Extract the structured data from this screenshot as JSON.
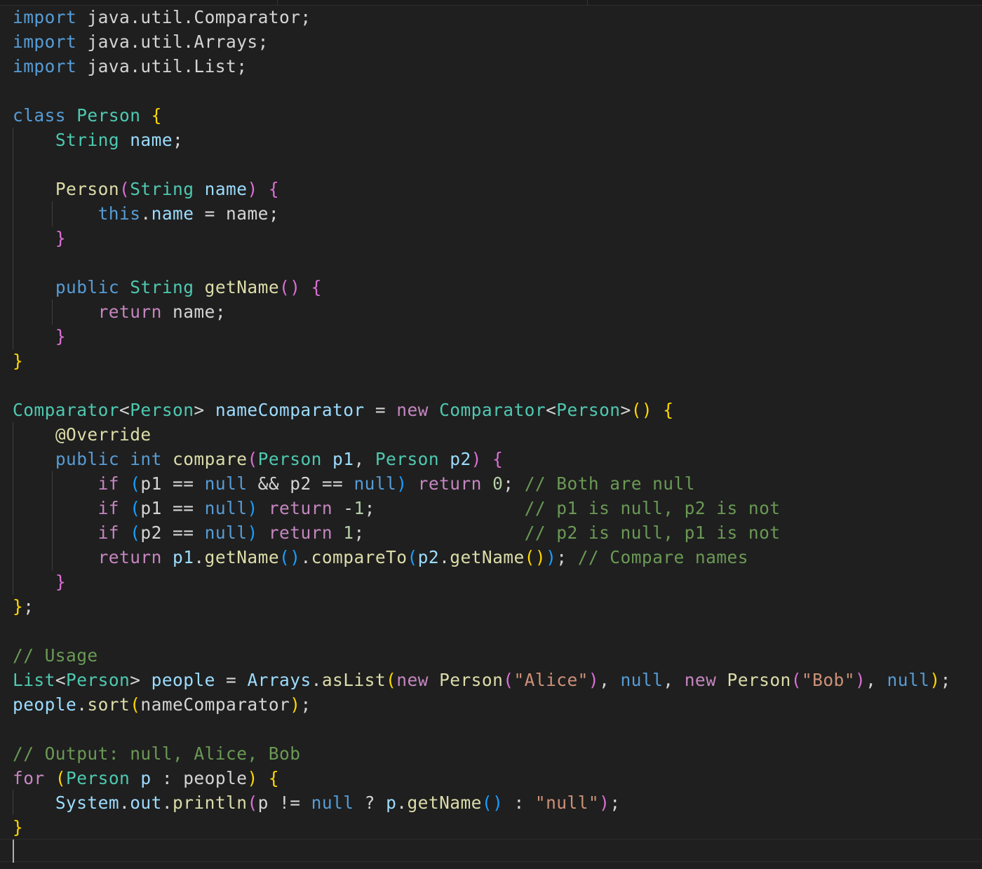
{
  "editor": {
    "language": "java",
    "theme": "dark",
    "colors": {
      "background": "#1f1f1f",
      "keyword": "#569cd6",
      "control": "#c586c0",
      "type": "#4ec9b0",
      "function": "#dcdcaa",
      "variable": "#9cdcfe",
      "string": "#ce9178",
      "number": "#b5cea8",
      "comment": "#6a9955",
      "bracket_1": "#ffd700",
      "bracket_2": "#da70d6",
      "bracket_3": "#179fff"
    },
    "lines": [
      [
        [
          "kw",
          "import"
        ],
        [
          "plain",
          " java.util.Comparator;"
        ]
      ],
      [
        [
          "kw",
          "import"
        ],
        [
          "plain",
          " java.util.Arrays;"
        ]
      ],
      [
        [
          "kw",
          "import"
        ],
        [
          "plain",
          " java.util.List;"
        ]
      ],
      [],
      [
        [
          "kw",
          "class"
        ],
        [
          "plain",
          " "
        ],
        [
          "type",
          "Person"
        ],
        [
          "plain",
          " "
        ],
        [
          "b1",
          "{"
        ]
      ],
      [
        [
          "plain",
          "    "
        ],
        [
          "type",
          "String"
        ],
        [
          "plain",
          " "
        ],
        [
          "var",
          "name"
        ],
        [
          "plain",
          ";"
        ]
      ],
      [],
      [
        [
          "plain",
          "    "
        ],
        [
          "fn",
          "Person"
        ],
        [
          "b2",
          "("
        ],
        [
          "type",
          "String"
        ],
        [
          "plain",
          " "
        ],
        [
          "var",
          "name"
        ],
        [
          "b2",
          ")"
        ],
        [
          "plain",
          " "
        ],
        [
          "b2",
          "{"
        ]
      ],
      [
        [
          "plain",
          "        "
        ],
        [
          "kw",
          "this"
        ],
        [
          "plain",
          "."
        ],
        [
          "var",
          "name"
        ],
        [
          "plain",
          " = name;"
        ]
      ],
      [
        [
          "plain",
          "    "
        ],
        [
          "b2",
          "}"
        ]
      ],
      [],
      [
        [
          "plain",
          "    "
        ],
        [
          "kw",
          "public"
        ],
        [
          "plain",
          " "
        ],
        [
          "type",
          "String"
        ],
        [
          "plain",
          " "
        ],
        [
          "fn",
          "getName"
        ],
        [
          "b2",
          "()"
        ],
        [
          "plain",
          " "
        ],
        [
          "b2",
          "{"
        ]
      ],
      [
        [
          "plain",
          "        "
        ],
        [
          "ctrl",
          "return"
        ],
        [
          "plain",
          " name;"
        ]
      ],
      [
        [
          "plain",
          "    "
        ],
        [
          "b2",
          "}"
        ]
      ],
      [
        [
          "b1",
          "}"
        ]
      ],
      [],
      [
        [
          "type",
          "Comparator"
        ],
        [
          "plain",
          "<"
        ],
        [
          "type",
          "Person"
        ],
        [
          "plain",
          "> "
        ],
        [
          "var",
          "nameComparator"
        ],
        [
          "plain",
          " = "
        ],
        [
          "ctrl",
          "new"
        ],
        [
          "plain",
          " "
        ],
        [
          "type",
          "Comparator"
        ],
        [
          "plain",
          "<"
        ],
        [
          "type",
          "Person"
        ],
        [
          "plain",
          ">"
        ],
        [
          "b1",
          "()"
        ],
        [
          "plain",
          " "
        ],
        [
          "b1",
          "{"
        ]
      ],
      [
        [
          "plain",
          "    "
        ],
        [
          "fn",
          "@Override"
        ]
      ],
      [
        [
          "plain",
          "    "
        ],
        [
          "kw",
          "public"
        ],
        [
          "plain",
          " "
        ],
        [
          "kw",
          "int"
        ],
        [
          "plain",
          " "
        ],
        [
          "fn",
          "compare"
        ],
        [
          "b2",
          "("
        ],
        [
          "type",
          "Person"
        ],
        [
          "plain",
          " "
        ],
        [
          "var",
          "p1"
        ],
        [
          "plain",
          ", "
        ],
        [
          "type",
          "Person"
        ],
        [
          "plain",
          " "
        ],
        [
          "var",
          "p2"
        ],
        [
          "b2",
          ")"
        ],
        [
          "plain",
          " "
        ],
        [
          "b2",
          "{"
        ]
      ],
      [
        [
          "plain",
          "        "
        ],
        [
          "ctrl",
          "if"
        ],
        [
          "plain",
          " "
        ],
        [
          "b3",
          "("
        ],
        [
          "plain",
          "p1 == "
        ],
        [
          "kw",
          "null"
        ],
        [
          "plain",
          " && p2 == "
        ],
        [
          "kw",
          "null"
        ],
        [
          "b3",
          ")"
        ],
        [
          "plain",
          " "
        ],
        [
          "ctrl",
          "return"
        ],
        [
          "plain",
          " "
        ],
        [
          "num",
          "0"
        ],
        [
          "plain",
          "; "
        ],
        [
          "com",
          "// Both are null"
        ]
      ],
      [
        [
          "plain",
          "        "
        ],
        [
          "ctrl",
          "if"
        ],
        [
          "plain",
          " "
        ],
        [
          "b3",
          "("
        ],
        [
          "plain",
          "p1 == "
        ],
        [
          "kw",
          "null"
        ],
        [
          "b3",
          ")"
        ],
        [
          "plain",
          " "
        ],
        [
          "ctrl",
          "return"
        ],
        [
          "plain",
          " -"
        ],
        [
          "num",
          "1"
        ],
        [
          "plain",
          ";              "
        ],
        [
          "com",
          "// p1 is null, p2 is not"
        ]
      ],
      [
        [
          "plain",
          "        "
        ],
        [
          "ctrl",
          "if"
        ],
        [
          "plain",
          " "
        ],
        [
          "b3",
          "("
        ],
        [
          "plain",
          "p2 == "
        ],
        [
          "kw",
          "null"
        ],
        [
          "b3",
          ")"
        ],
        [
          "plain",
          " "
        ],
        [
          "ctrl",
          "return"
        ],
        [
          "plain",
          " "
        ],
        [
          "num",
          "1"
        ],
        [
          "plain",
          ";               "
        ],
        [
          "com",
          "// p2 is null, p1 is not"
        ]
      ],
      [
        [
          "plain",
          "        "
        ],
        [
          "ctrl",
          "return"
        ],
        [
          "plain",
          " "
        ],
        [
          "var",
          "p1"
        ],
        [
          "plain",
          "."
        ],
        [
          "fn",
          "getName"
        ],
        [
          "b3",
          "()"
        ],
        [
          "plain",
          "."
        ],
        [
          "fn",
          "compareTo"
        ],
        [
          "b3",
          "("
        ],
        [
          "var",
          "p2"
        ],
        [
          "plain",
          "."
        ],
        [
          "fn",
          "getName"
        ],
        [
          "b1",
          "()"
        ],
        [
          "b3",
          ")"
        ],
        [
          "plain",
          "; "
        ],
        [
          "com",
          "// Compare names"
        ]
      ],
      [
        [
          "plain",
          "    "
        ],
        [
          "b2",
          "}"
        ]
      ],
      [
        [
          "b1",
          "}"
        ],
        [
          "plain",
          ";"
        ]
      ],
      [],
      [
        [
          "com",
          "// Usage"
        ]
      ],
      [
        [
          "type",
          "List"
        ],
        [
          "plain",
          "<"
        ],
        [
          "type",
          "Person"
        ],
        [
          "plain",
          "> "
        ],
        [
          "var",
          "people"
        ],
        [
          "plain",
          " = "
        ],
        [
          "var",
          "Arrays"
        ],
        [
          "plain",
          "."
        ],
        [
          "fn",
          "asList"
        ],
        [
          "b1",
          "("
        ],
        [
          "ctrl",
          "new"
        ],
        [
          "plain",
          " "
        ],
        [
          "fn",
          "Person"
        ],
        [
          "b2",
          "("
        ],
        [
          "str",
          "\"Alice\""
        ],
        [
          "b2",
          ")"
        ],
        [
          "plain",
          ", "
        ],
        [
          "kw",
          "null"
        ],
        [
          "plain",
          ", "
        ],
        [
          "ctrl",
          "new"
        ],
        [
          "plain",
          " "
        ],
        [
          "fn",
          "Person"
        ],
        [
          "b2",
          "("
        ],
        [
          "str",
          "\"Bob\""
        ],
        [
          "b2",
          ")"
        ],
        [
          "plain",
          ", "
        ],
        [
          "kw",
          "null"
        ],
        [
          "b1",
          ")"
        ],
        [
          "plain",
          ";"
        ]
      ],
      [
        [
          "var",
          "people"
        ],
        [
          "plain",
          "."
        ],
        [
          "fn",
          "sort"
        ],
        [
          "b1",
          "("
        ],
        [
          "plain",
          "nameComparator"
        ],
        [
          "b1",
          ")"
        ],
        [
          "plain",
          ";"
        ]
      ],
      [],
      [
        [
          "com",
          "// Output: null, Alice, Bob"
        ]
      ],
      [
        [
          "ctrl",
          "for"
        ],
        [
          "plain",
          " "
        ],
        [
          "b1",
          "("
        ],
        [
          "type",
          "Person"
        ],
        [
          "plain",
          " "
        ],
        [
          "var",
          "p"
        ],
        [
          "plain",
          " : people"
        ],
        [
          "b1",
          ")"
        ],
        [
          "plain",
          " "
        ],
        [
          "b1",
          "{"
        ]
      ],
      [
        [
          "plain",
          "    "
        ],
        [
          "var",
          "System"
        ],
        [
          "plain",
          "."
        ],
        [
          "var",
          "out"
        ],
        [
          "plain",
          "."
        ],
        [
          "fn",
          "println"
        ],
        [
          "b2",
          "("
        ],
        [
          "plain",
          "p != "
        ],
        [
          "kw",
          "null"
        ],
        [
          "plain",
          " ? "
        ],
        [
          "var",
          "p"
        ],
        [
          "plain",
          "."
        ],
        [
          "fn",
          "getName"
        ],
        [
          "b3",
          "()"
        ],
        [
          "plain",
          " : "
        ],
        [
          "str",
          "\"null\""
        ],
        [
          "b2",
          ")"
        ],
        [
          "plain",
          ";"
        ]
      ],
      [
        [
          "b1",
          "}"
        ]
      ],
      []
    ]
  }
}
